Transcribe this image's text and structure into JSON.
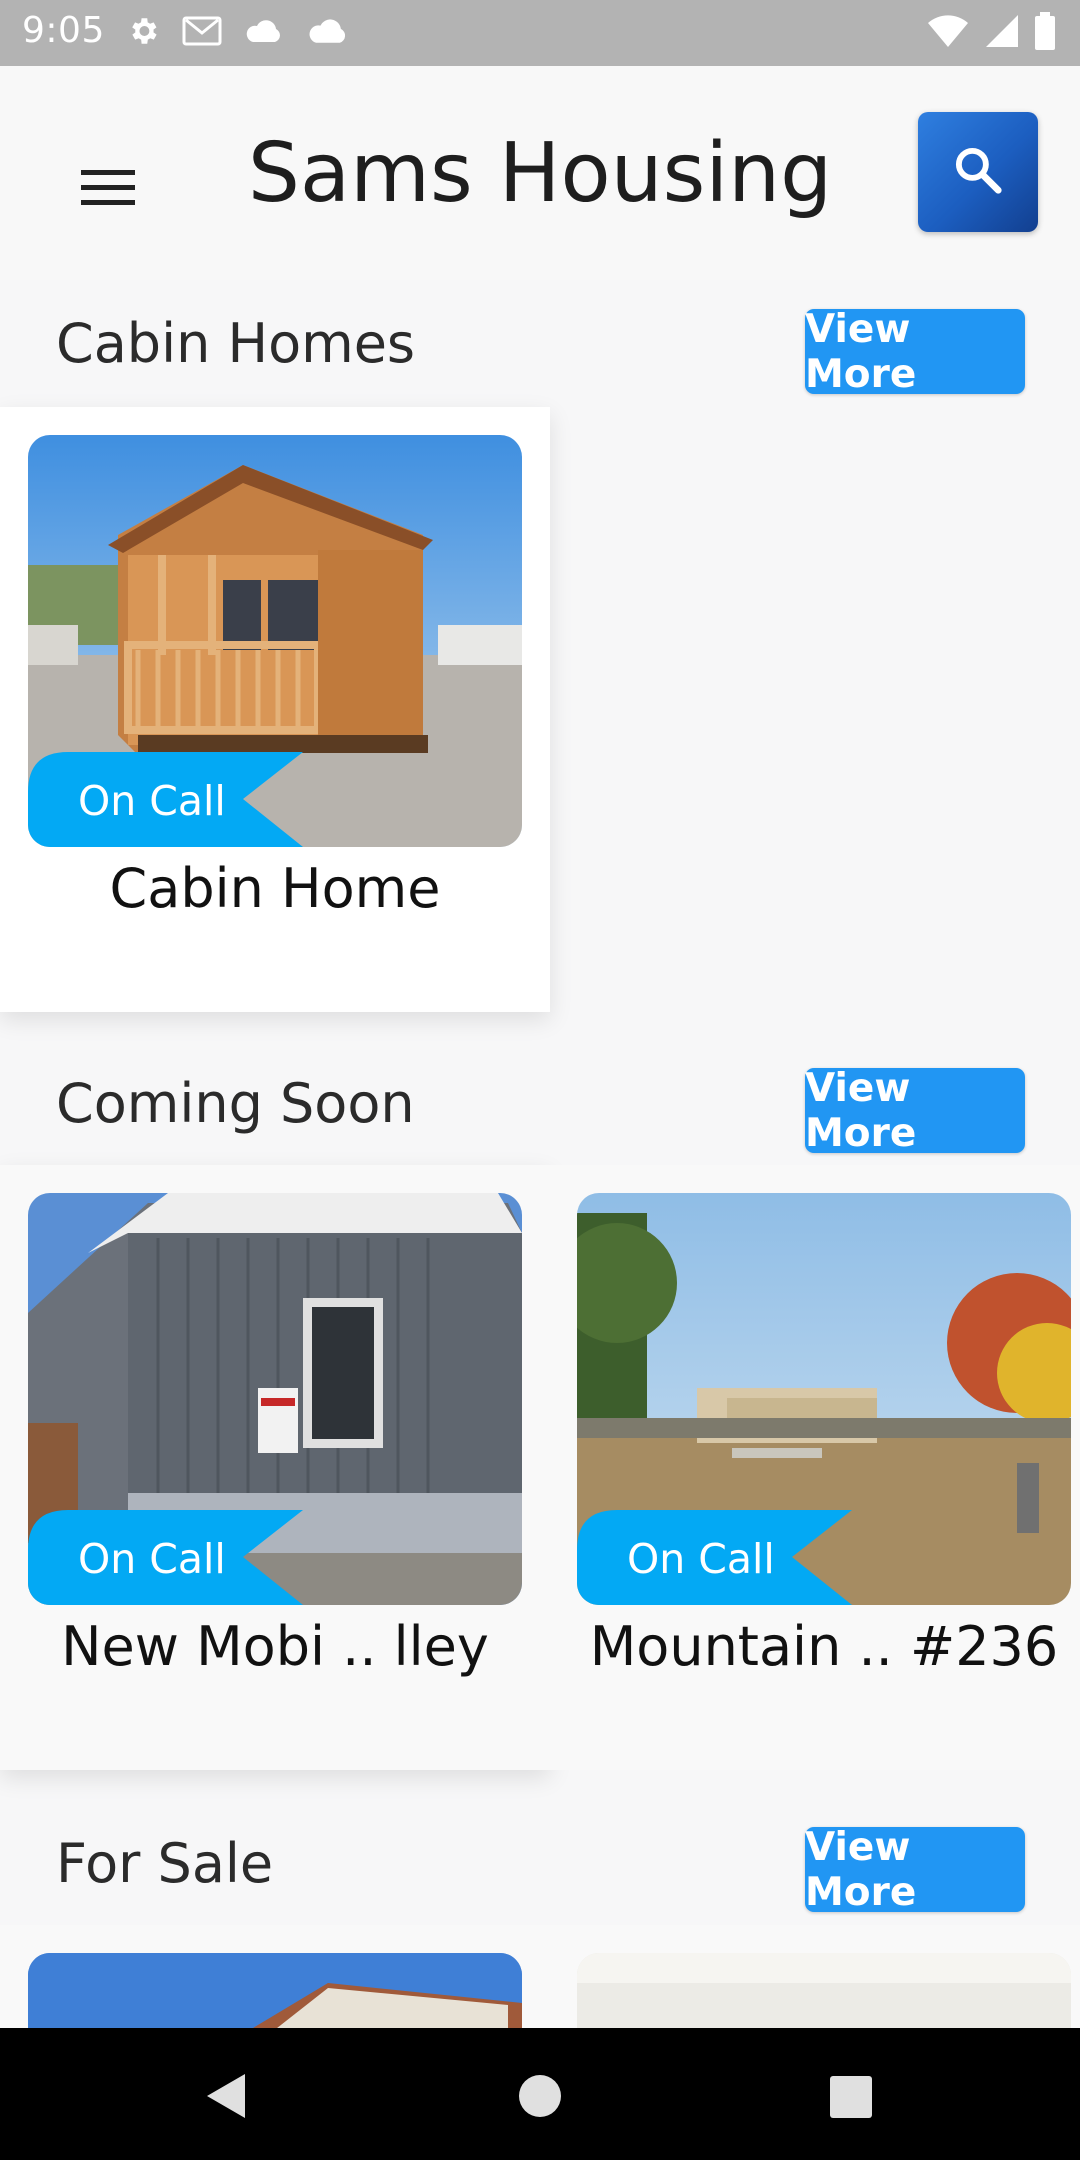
{
  "status_bar": {
    "time": "9:05",
    "left_icons": [
      "settings-icon",
      "gmail-icon",
      "cloud-icon",
      "cloud-icon"
    ],
    "right_icons": [
      "wifi-icon",
      "signal-icon",
      "battery-icon"
    ]
  },
  "app_bar": {
    "title": "Sams Housing",
    "menu_icon": "menu-icon",
    "search_icon": "search-icon"
  },
  "sections": [
    {
      "title": "Cabin Homes",
      "view_more": "View More",
      "cards": [
        {
          "badge": "On Call",
          "title": "Cabin Home"
        }
      ]
    },
    {
      "title": "Coming Soon",
      "view_more": "View More",
      "cards": [
        {
          "badge": "On Call",
          "title": "New Mobi .. lley"
        },
        {
          "badge": "On Call",
          "title": "Mountain .. #236"
        }
      ]
    },
    {
      "title": "For Sale",
      "view_more": "View More",
      "cards": []
    }
  ],
  "nav_bar": {
    "buttons": [
      "back-icon",
      "home-icon",
      "recents-icon"
    ]
  },
  "colors": {
    "accent": "#2196f3",
    "ribbon": "#03a9f4",
    "search_button": "#1c5ec0"
  }
}
